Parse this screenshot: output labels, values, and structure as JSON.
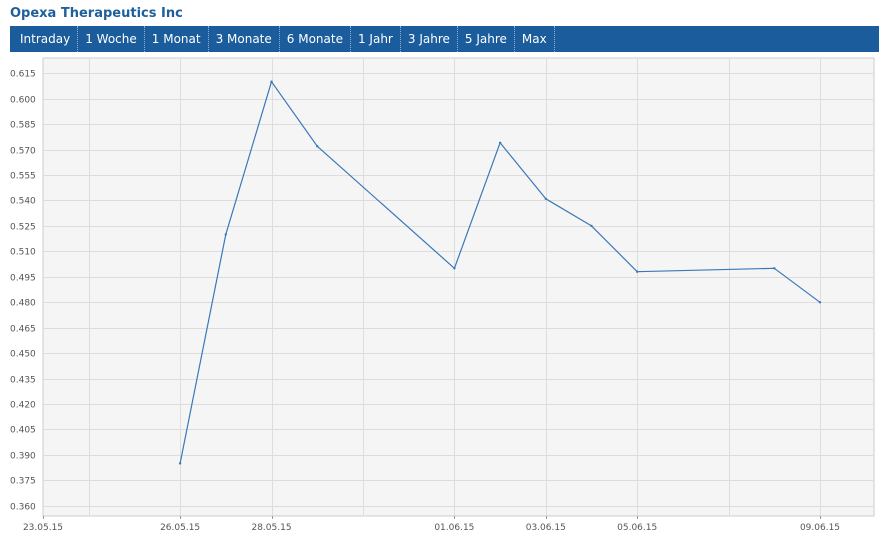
{
  "header": {
    "title": "Opexa Therapeutics Inc"
  },
  "tabs": [
    {
      "label": "Intraday"
    },
    {
      "label": "1 Woche"
    },
    {
      "label": "1 Monat"
    },
    {
      "label": "3 Monate"
    },
    {
      "label": "6 Monate"
    },
    {
      "label": "1 Jahr"
    },
    {
      "label": "3 Jahre"
    },
    {
      "label": "5 Jahre"
    },
    {
      "label": "Max"
    }
  ],
  "colors": {
    "tab_bar": "#1a5c9c",
    "title": "#1f5f9c",
    "line": "#3a78b8",
    "plot_background": "#f5f5f5",
    "grid": "#dddddd"
  },
  "chart_data": {
    "type": "line",
    "title": "",
    "xlabel": "",
    "ylabel": "",
    "x_tick_labels": [
      "23.05.15",
      "26.05.15",
      "28.05.15",
      "01.06.15",
      "03.06.15",
      "05.06.15",
      "09.06.15"
    ],
    "y_tick_labels": [
      "0.615",
      "0.600",
      "0.585",
      "0.570",
      "0.555",
      "0.540",
      "0.525",
      "0.510",
      "0.495",
      "0.480",
      "0.465",
      "0.450",
      "0.435",
      "0.420",
      "0.405",
      "0.390",
      "0.375",
      "0.360"
    ],
    "ylim": [
      0.354,
      0.624
    ],
    "xlim": [
      "2015-05-23",
      "2015-06-09"
    ],
    "grid": true,
    "legend": "none",
    "series": [
      {
        "x": [
          "2015-05-26",
          "2015-05-27",
          "2015-05-28",
          "2015-05-29",
          "2015-06-01",
          "2015-06-02",
          "2015-06-03",
          "2015-06-04",
          "2015-06-05",
          "2015-06-08",
          "2015-06-09"
        ],
        "y": [
          0.385,
          0.52,
          0.61,
          0.572,
          0.5,
          0.574,
          0.541,
          0.525,
          0.498,
          0.5,
          0.48
        ]
      }
    ]
  }
}
